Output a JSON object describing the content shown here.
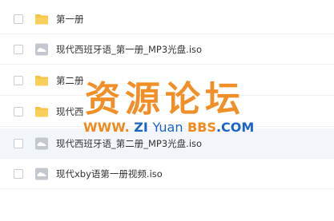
{
  "files": [
    {
      "type": "folder",
      "icon": "folder-icon",
      "name": "第一册"
    },
    {
      "type": "file",
      "icon": "cloud-file-icon",
      "name": "现代西班牙语_第一册_MP3光盘.iso"
    },
    {
      "type": "folder",
      "icon": "folder-icon",
      "name": "第二册"
    },
    {
      "type": "folder",
      "icon": "folder-icon",
      "name": "现代西"
    },
    {
      "type": "file",
      "icon": "cloud-file-icon",
      "name": "现代西班牙语_第二册_MP3光盘.iso"
    },
    {
      "type": "file",
      "icon": "cloud-file-icon",
      "name": "现代xby语第一册视频.iso"
    }
  ],
  "watermark": {
    "title": "资源论坛",
    "url_www": "WWW.",
    "url_zi": "ZI",
    "url_yuan": "Yuan",
    "url_bbs": "BBS",
    "url_com": ".COM"
  },
  "colors": {
    "folder": "#f5c242",
    "cloud_file": "#b9bec6",
    "watermark_orange": "#f08a1c",
    "watermark_blue": "#1e63c8"
  }
}
